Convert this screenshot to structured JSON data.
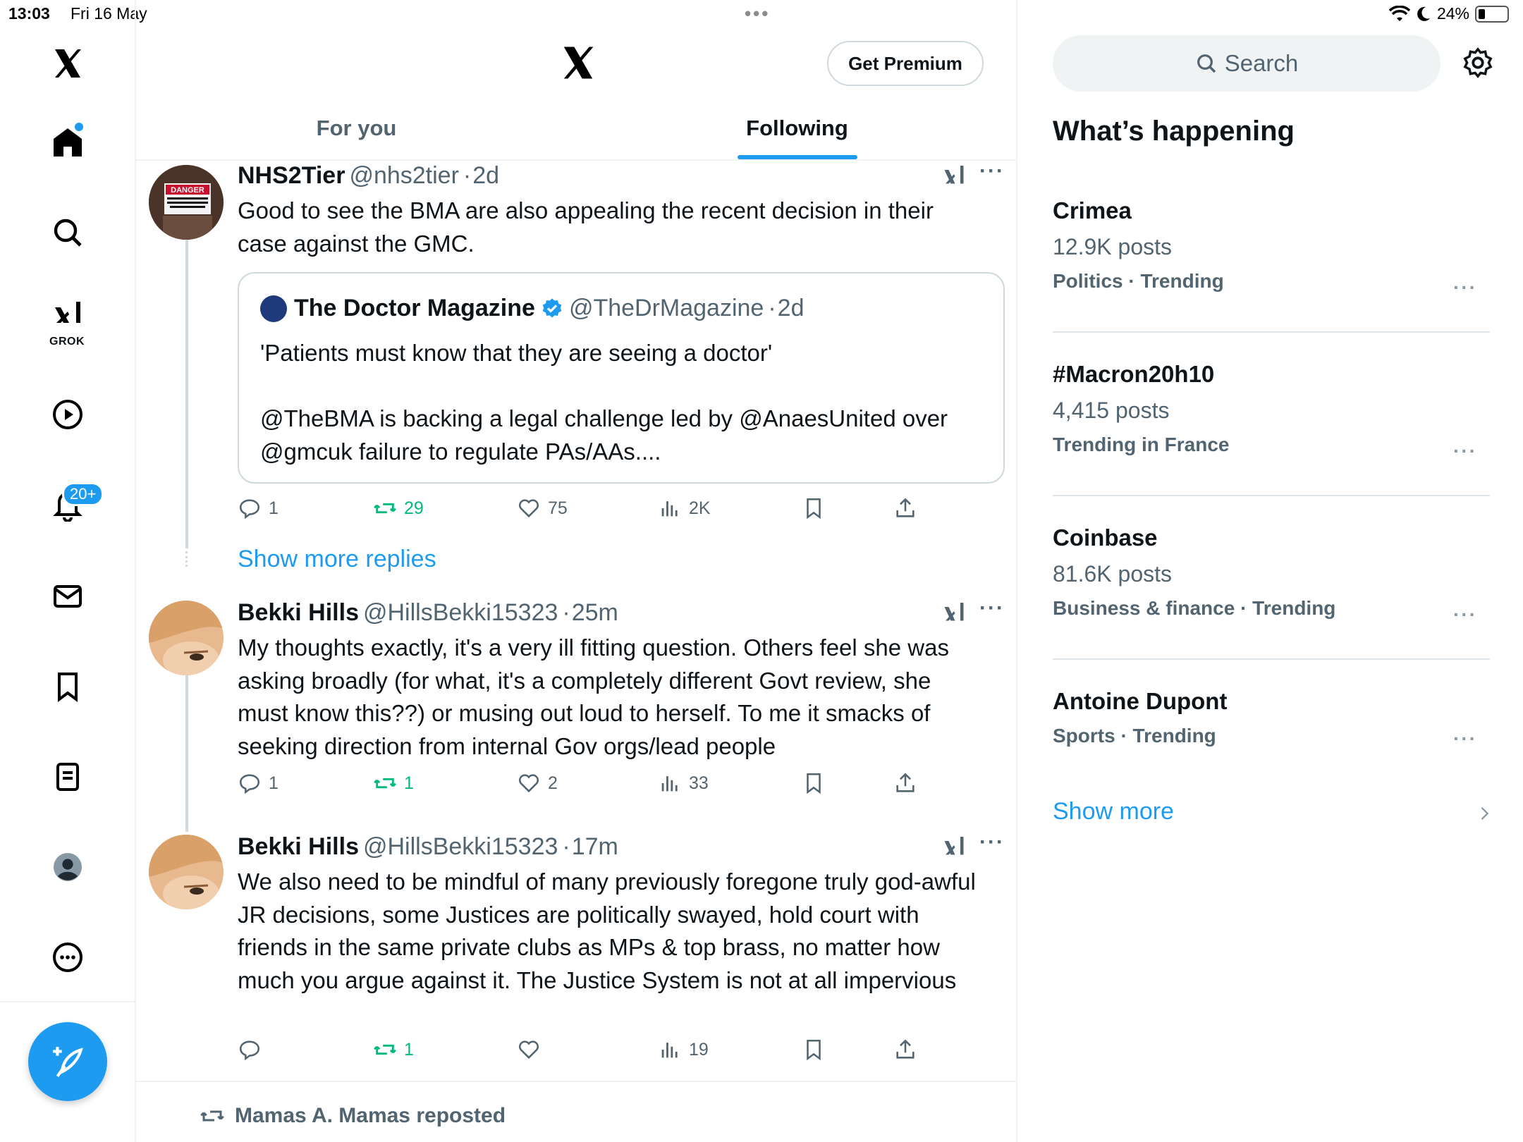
{
  "status_bar": {
    "time": "13:03",
    "date": "Fri 16 May",
    "battery": "24%",
    "battery_level": 0.24
  },
  "nav": {
    "grok_label": "GROK",
    "notifications_badge": "20+"
  },
  "header": {
    "premium_label": "Get Premium"
  },
  "tabs": [
    {
      "label": "For you"
    },
    {
      "label": "Following"
    }
  ],
  "posts": [
    {
      "name": "NHS2Tier",
      "handle": "@nhs2tier",
      "time": "2d",
      "text": "Good to see the BMA are also appealing the recent decision in their case against the GMC.",
      "quote": {
        "name": "The Doctor Magazine",
        "handle": "@TheDrMagazine",
        "time": "2d",
        "text": "'Patients must know that they are seeing a doctor'\n\n@TheBMA is backing a legal challenge led by @AnaesUnited over @gmcuk failure to regulate PAs/AAs...."
      },
      "replies": "1",
      "reposts": "29",
      "likes": "75",
      "views": "2K"
    },
    {
      "name": "Bekki Hills",
      "handle": "@HillsBekki15323",
      "time": "25m",
      "text": "My thoughts exactly, it's a very ill fitting question. Others feel she was asking broadly (for what, it's a completely different Govt review, she must know this??) or musing out loud to herself. To me it smacks of seeking direction from internal Gov orgs/lead people",
      "replies": "1",
      "reposts": "1",
      "likes": "2",
      "views": "33"
    },
    {
      "name": "Bekki Hills",
      "handle": "@HillsBekki15323",
      "time": "17m",
      "text": "We also need to be mindful of many previously foregone truly god-awful JR decisions, some Justices are politically swayed, hold court with friends in the same private clubs as MPs & top brass, no matter how much you argue against it. The Justice System is not at all impervious",
      "replies": "",
      "reposts": "1",
      "likes": "",
      "views": "19"
    }
  ],
  "show_more_replies": "Show more replies",
  "repost_notice": "Mamas A. Mamas reposted",
  "sidebar": {
    "search_placeholder": "Search",
    "trends_title": "What’s happening",
    "trends": [
      {
        "name": "Crimea",
        "count": "12.9K posts",
        "category": "Politics · Trending"
      },
      {
        "name": "#Macron20h10",
        "count": "4,415 posts",
        "category": "Trending in France"
      },
      {
        "name": "Coinbase",
        "count": "81.6K posts",
        "category": "Business & finance · Trending"
      },
      {
        "name": "Antoine Dupont",
        "count": "",
        "category": "Sports · Trending"
      }
    ],
    "show_more": "Show more"
  },
  "colors": {
    "accent": "#1d9bf0",
    "repost_green": "#00ba7c",
    "muted": "#536471"
  }
}
